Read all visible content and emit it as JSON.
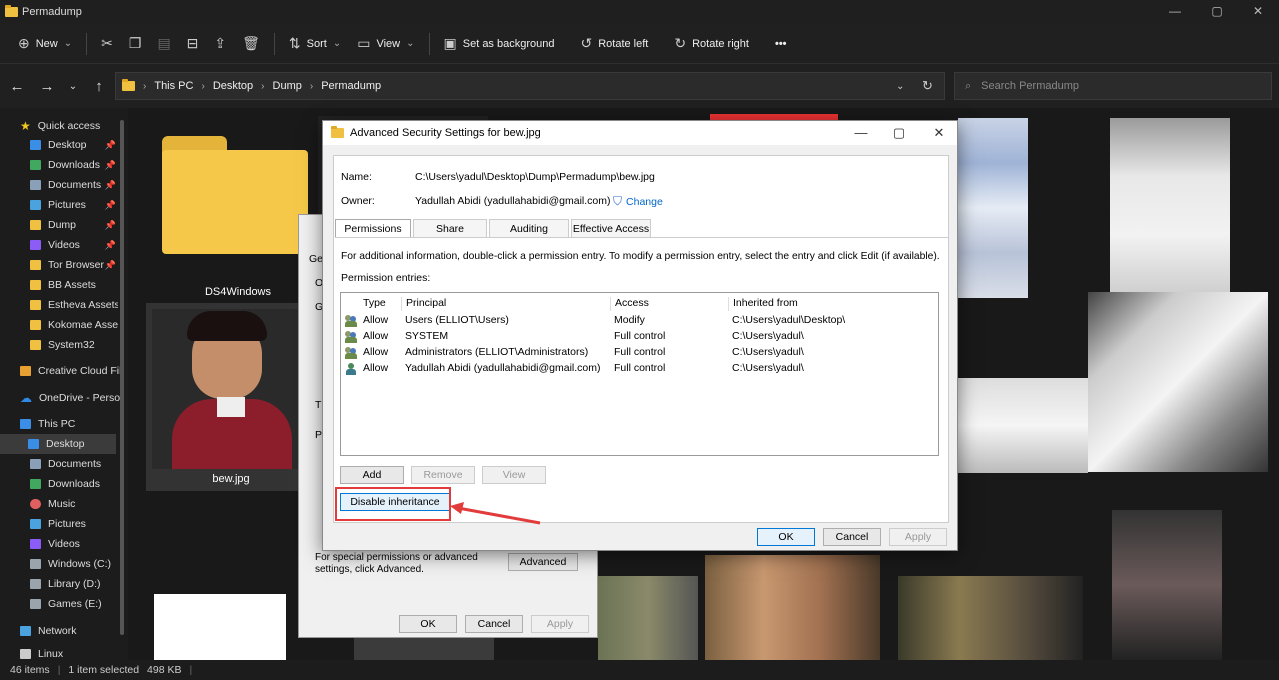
{
  "window": {
    "title": "Permadump",
    "minimize": "—",
    "maximize": "▢",
    "close": "✕"
  },
  "toolbar": {
    "new": "New",
    "sort": "Sort",
    "view": "View",
    "set_bg": "Set as background",
    "rotate_left": "Rotate left",
    "rotate_right": "Rotate right",
    "more": "•••"
  },
  "address": {
    "crumbs": [
      "This PC",
      "Desktop",
      "Dump",
      "Permadump"
    ],
    "search_placeholder": "Search Permadump"
  },
  "sidebar": {
    "items": [
      {
        "label": "Quick access",
        "icon": "star-icon",
        "color": "#f3c623"
      },
      {
        "label": "Desktop",
        "icon": "desktop-icon",
        "color": "#3a8ee6",
        "pinned": true
      },
      {
        "label": "Downloads",
        "icon": "download-icon",
        "color": "#41a85f",
        "pinned": true
      },
      {
        "label": "Documents",
        "icon": "document-icon",
        "color": "#8aa0b8",
        "pinned": true
      },
      {
        "label": "Pictures",
        "icon": "pictures-icon",
        "color": "#4aa3df",
        "pinned": true
      },
      {
        "label": "Dump",
        "icon": "folder-icon",
        "color": "#f0c040",
        "pinned": true
      },
      {
        "label": "Videos",
        "icon": "videos-icon",
        "color": "#8b5cf6",
        "pinned": true
      },
      {
        "label": "Tor Browser",
        "icon": "folder-icon",
        "color": "#f0c040",
        "pinned": true
      },
      {
        "label": "BB Assets",
        "icon": "folder-icon",
        "color": "#f0c040"
      },
      {
        "label": "Estheva Assets",
        "icon": "folder-icon",
        "color": "#f0c040"
      },
      {
        "label": "Kokomae Assets",
        "icon": "folder-icon",
        "color": "#f0c040"
      },
      {
        "label": "System32",
        "icon": "folder-icon",
        "color": "#f0c040"
      },
      {
        "label": "Creative Cloud Fil",
        "icon": "folder-icon",
        "color": "#e8a030"
      },
      {
        "label": "OneDrive - Persor",
        "icon": "cloud-icon",
        "color": "#2f8ae6"
      },
      {
        "label": "This PC",
        "icon": "computer-icon",
        "color": "#3a8ee6"
      },
      {
        "label": "Desktop",
        "icon": "desktop-icon",
        "color": "#3a8ee6"
      },
      {
        "label": "Documents",
        "icon": "document-icon",
        "color": "#8aa0b8"
      },
      {
        "label": "Downloads",
        "icon": "download-icon",
        "color": "#41a85f"
      },
      {
        "label": "Music",
        "icon": "music-icon",
        "color": "#e06060"
      },
      {
        "label": "Pictures",
        "icon": "pictures-icon",
        "color": "#4aa3df"
      },
      {
        "label": "Videos",
        "icon": "videos-icon",
        "color": "#8b5cf6"
      },
      {
        "label": "Windows (C:)",
        "icon": "drive-icon",
        "color": "#9aa4ad"
      },
      {
        "label": "Library (D:)",
        "icon": "drive-icon",
        "color": "#9aa4ad"
      },
      {
        "label": "Games (E:)",
        "icon": "drive-icon",
        "color": "#9aa4ad"
      },
      {
        "label": "Network",
        "icon": "network-icon",
        "color": "#4aa3df"
      },
      {
        "label": "Linux",
        "icon": "linux-icon",
        "color": "#cccccc"
      }
    ]
  },
  "files": {
    "folder_label": "DS4Windows",
    "image_label": "bew.jpg"
  },
  "status": {
    "items": "46 items",
    "selected": "1 item selected",
    "size": "498 KB"
  },
  "props_dialog": {
    "ge": "Ge",
    "o": "O",
    "g": "G",
    "t": "T",
    "p": "P",
    "special_text": "For special permissions or advanced settings, click Advanced.",
    "advanced": "Advanced",
    "ok": "OK",
    "cancel": "Cancel",
    "apply": "Apply"
  },
  "adv": {
    "title": "Advanced Security Settings for bew.jpg",
    "name_label": "Name:",
    "name_value": "C:\\Users\\yadul\\Desktop\\Dump\\Permadump\\bew.jpg",
    "owner_label": "Owner:",
    "owner_value": "Yadullah Abidi (yadullahabidi@gmail.com)",
    "change": "Change",
    "tabs": [
      "Permissions",
      "Share",
      "Auditing",
      "Effective Access"
    ],
    "info": "For additional information, double-click a permission entry. To modify a permission entry, select the entry and click Edit (if available).",
    "entries_label": "Permission entries:",
    "columns": [
      "Type",
      "Principal",
      "Access",
      "Inherited from"
    ],
    "rows": [
      {
        "type": "Allow",
        "principal": "Users (ELLIOT\\Users)",
        "access": "Modify",
        "inherited": "C:\\Users\\yadul\\Desktop\\"
      },
      {
        "type": "Allow",
        "principal": "SYSTEM",
        "access": "Full control",
        "inherited": "C:\\Users\\yadul\\"
      },
      {
        "type": "Allow",
        "principal": "Administrators (ELLIOT\\Administrators)",
        "access": "Full control",
        "inherited": "C:\\Users\\yadul\\"
      },
      {
        "type": "Allow",
        "principal": "Yadullah Abidi (yadullahabidi@gmail.com)",
        "access": "Full control",
        "inherited": "C:\\Users\\yadul\\"
      }
    ],
    "add": "Add",
    "remove": "Remove",
    "view": "View",
    "disable_inheritance": "Disable inheritance",
    "ok": "OK",
    "cancel": "Cancel",
    "apply": "Apply"
  }
}
